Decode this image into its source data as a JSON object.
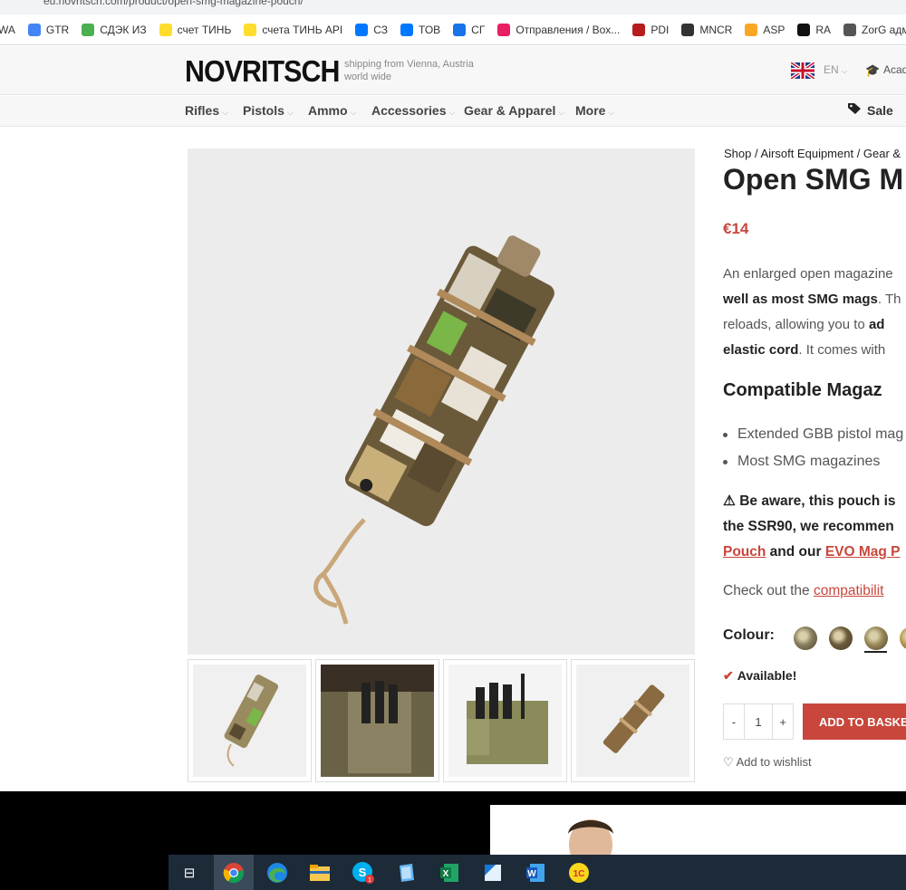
{
  "browser": {
    "url_fragment": "eu.novritsch.com/product/open-smg-magazine-pouch/",
    "bookmarks": [
      {
        "label": "WA",
        "icon": "whatsapp-icon",
        "color": ""
      },
      {
        "label": "GTR",
        "icon": "translate-icon",
        "color": "#4285f4"
      },
      {
        "label": "СДЭК ИЗ",
        "icon": "cdek-icon",
        "color": "#4caf50"
      },
      {
        "label": "счет ТИНЬ",
        "icon": "tinkoff-icon",
        "color": "#ffdd2d"
      },
      {
        "label": "счета ТИНЬ API",
        "icon": "tinkoff-icon",
        "color": "#ffdd2d"
      },
      {
        "label": "СЗ",
        "icon": "vk-icon",
        "color": "#0077ff"
      },
      {
        "label": "ТОВ",
        "icon": "vk-icon",
        "color": "#0077ff"
      },
      {
        "label": "СГ",
        "icon": "chat-icon",
        "color": "#1a73e8"
      },
      {
        "label": "Отправления / Box...",
        "icon": "box-icon",
        "color": "#e91e63"
      },
      {
        "label": "PDI",
        "icon": "pdi-icon",
        "color": "#b71c1c"
      },
      {
        "label": "MNCR",
        "icon": "mncr-icon",
        "color": "#333333"
      },
      {
        "label": "ASP",
        "icon": "asp-icon",
        "color": "#f9a825"
      },
      {
        "label": "RA",
        "icon": "ra-icon",
        "color": "#111111"
      },
      {
        "label": "ZorG адми",
        "icon": "globe-icon",
        "color": "#555555"
      }
    ]
  },
  "header": {
    "logo": "NOVRITSCH",
    "tagline_1": "shipping from Vienna, Austria",
    "tagline_2": "world wide",
    "lang": "EN",
    "academy": "Acad"
  },
  "nav": {
    "items": [
      "Rifles",
      "Pistols",
      "Ammo",
      "Accessories",
      "Gear & Apparel",
      "More"
    ],
    "sale": "Sale"
  },
  "product": {
    "breadcrumb": "Shop / Airsoft Equipment / Gear &",
    "title": "Open SMG M",
    "price": "€14",
    "desc": {
      "line1": "An enlarged open magazine",
      "line2_bold": "well as most SMG mags",
      "line2_rest": ". Th",
      "line3_a": "reloads, allowing you to ",
      "line3_bold": "ad",
      "line4_bold": "elastic cord",
      "line4_rest": ". It comes with"
    },
    "compat_heading": "Compatible Magaz",
    "compat_items": [
      "Extended GBB pistol mag",
      "Most SMG magazines"
    ],
    "warning": {
      "line1": "Be aware, this pouch is",
      "line2": "the SSR90, we recommen",
      "link1": "Pouch",
      "and": " and our ",
      "link2": "EVO Mag P"
    },
    "checkout_text": "Check out the ",
    "checkout_link": "compatibilit",
    "colour_label": "Colour:",
    "swatches": [
      "#8a8060",
      "#6b5a3a",
      "#9a8a5a",
      "#b89a50"
    ],
    "availability": "Available!",
    "qty_minus": "-",
    "qty_value": "1",
    "qty_plus": "+",
    "add_button": "ADD TO BASKET",
    "wishlist": "Add to wishlist"
  }
}
